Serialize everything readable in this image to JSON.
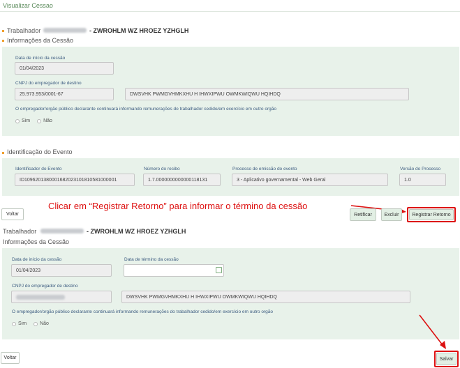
{
  "page_title": "Visualizar Cessao",
  "top_section": {
    "worker_label": "Trabalhador",
    "worker_name": "- ZWROHLM WZ HROEZ YZHGLH",
    "info_title": "Informações da Cessão",
    "start_date_label": "Data de início da cessão",
    "start_date_value": "01/04/2023",
    "cnpj_label": "CNPJ do empregador de destino",
    "cnpj_value": "25.973.953/0001-67",
    "company_name": "DWSVHK PWMGVHMKXHU H IHWXIPWU OWMKWIQWU HQIHDQ",
    "question": "O empregador/orgão público declarante continuará informando remunerações do trabalhador cedido/em exercício em outro orgão",
    "options": [
      "Sim",
      "Não"
    ]
  },
  "event_section": {
    "title": "Identificação do Evento",
    "id_label": "Identificador do Evento",
    "id_value": "ID1096201380001682023101810581000001",
    "receipt_label": "Número do recibo",
    "receipt_value": "1.7.0000000000000118131",
    "process_label": "Processo de emissão do evento",
    "process_value": "3 - Aplicativo governamental - Web Geral",
    "version_label": "Versão do Processo",
    "version_value": "1.0"
  },
  "toolbar1": {
    "back_label": "Voltar",
    "rectify_label": "Retificar",
    "delete_label": "Excluir",
    "register_return_label": "Registrar Retorno"
  },
  "annotation_text": "Clicar em “Registrar Retorno” para informar o término da cessão",
  "bottom_section": {
    "worker_label": "Trabalhador",
    "worker_name": "- ZWROHLM WZ HROEZ YZHGLH",
    "info_title": "Informações da Cessão",
    "start_date_label": "Data de início da cessão",
    "start_date_value": "01/04/2023",
    "end_date_label": "Data de término da cessão",
    "end_date_value": "",
    "cnpj_label": "CNPJ do empregador de destino",
    "company_name": "DWSVHK PWMGVHMKXHU H IHWXIPWU OWMKWIQWU HQIHDQ",
    "question": "O empregador/orgão público declarante continuará informando remunerações do trabalhador cedido/em exercício em outro orgão",
    "options": [
      "Sim",
      "Não"
    ]
  },
  "toolbar2": {
    "back_label": "Voltar",
    "save_label": "Salvar"
  },
  "colors": {
    "panel": "#e8f2ea",
    "accent_bullet": "#f0a030",
    "highlight": "#dd1111",
    "label_blue": "#3d5c80"
  }
}
